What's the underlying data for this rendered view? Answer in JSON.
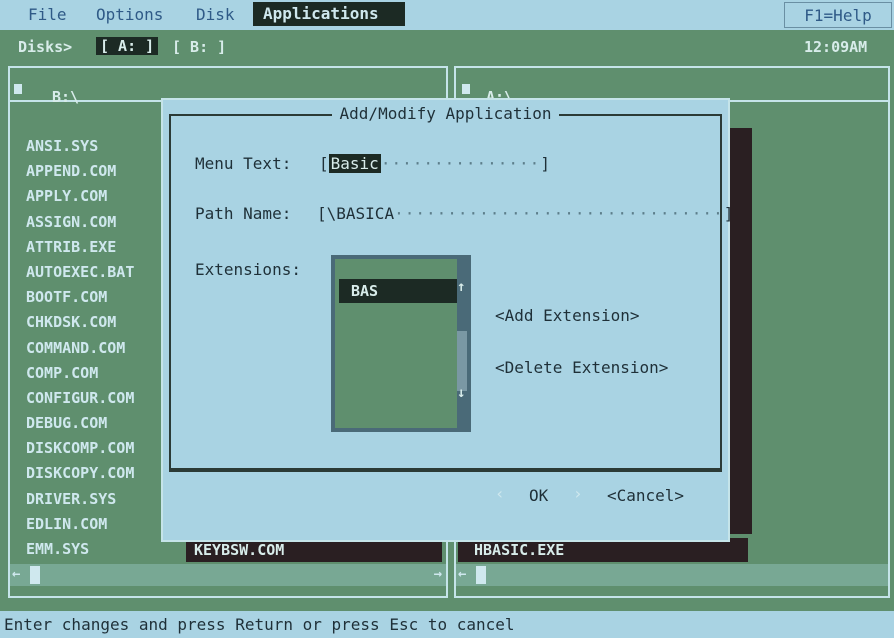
{
  "menu": {
    "items": [
      "File",
      "Options",
      "Disk",
      "Applications"
    ],
    "help": "F1=Help"
  },
  "disks": {
    "label": "Disks>",
    "drives": [
      "[ A: ]",
      "[ B: ]"
    ],
    "time": "12:09AM"
  },
  "left_panel": {
    "path": "B:\\",
    "files": [
      "ANSI.SYS",
      "APPEND.COM",
      "APPLY.COM",
      "ASSIGN.COM",
      "ATTRIB.EXE",
      "AUTOEXEC.BAT",
      "BOOTF.COM",
      "CHKDSK.COM",
      "COMMAND.COM",
      "COMP.COM",
      "CONFIGUR.COM",
      "DEBUG.COM",
      "DISKCOMP.COM",
      "DISKCOPY.COM",
      "DRIVER.SYS",
      "EDLIN.COM",
      "EMM.SYS"
    ],
    "selected_file": "KEYBSW.COM"
  },
  "right_panel": {
    "path": "A:\\",
    "selected_file": "HBASIC.EXE"
  },
  "dialog": {
    "title": "Add/Modify Application",
    "menu_text_label": "Menu Text:",
    "menu_text_value": "Basic",
    "path_name_label": "Path Name:",
    "path_name_value": "\\BASICA",
    "extensions_label": "Extensions:",
    "extensions": [
      "BAS"
    ],
    "add_extension": "<Add Extension>",
    "delete_extension": "<Delete Extension>",
    "ok": "OK",
    "cancel": "<Cancel>"
  },
  "status": "Enter changes and press Return or press Esc to cancel",
  "colors": {
    "background": "#5f8f6e",
    "menubar": "#a9d3e3",
    "highlight": "#1c2a24",
    "file_text": "#cfe8ee"
  }
}
